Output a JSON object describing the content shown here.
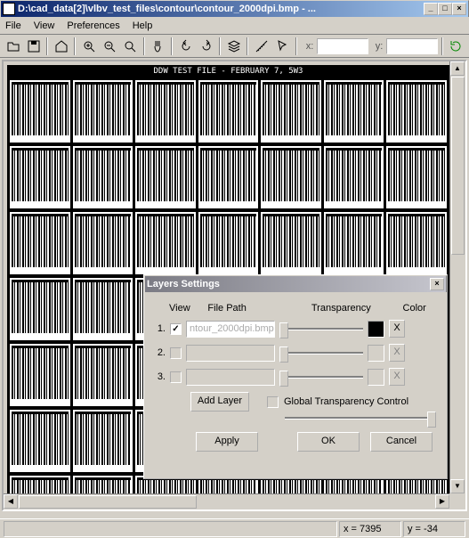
{
  "window": {
    "title": "D:\\cad_data[2]\\vlbv_test_files\\contour\\contour_2000dpi.bmp - ...",
    "min": "_",
    "max": "□",
    "close": "×"
  },
  "menu": {
    "file": "File",
    "view": "View",
    "prefs": "Preferences",
    "help": "Help"
  },
  "toolbar": {
    "x_label": "x:",
    "y_label": "y:"
  },
  "canvas": {
    "header": "DDW TEST FILE - FEBRUARY 7, 5W3"
  },
  "status": {
    "x": "x = 7395",
    "y": "y = -34"
  },
  "dialog": {
    "title": "Layers Settings",
    "close": "×",
    "headers": {
      "view": "View",
      "path": "File Path",
      "trans": "Transparency",
      "color": "Color"
    },
    "rows": [
      {
        "num": "1.",
        "checked": "✓",
        "path": "ntour_2000dpi.bmp",
        "x": "X",
        "enabled": true
      },
      {
        "num": "2.",
        "checked": "",
        "path": "",
        "x": "X",
        "enabled": false
      },
      {
        "num": "3.",
        "checked": "",
        "path": "",
        "x": "X",
        "enabled": false
      }
    ],
    "add_layer": "Add Layer",
    "gtc_label": "Global Transparency Control",
    "apply": "Apply",
    "ok": "OK",
    "cancel": "Cancel"
  }
}
